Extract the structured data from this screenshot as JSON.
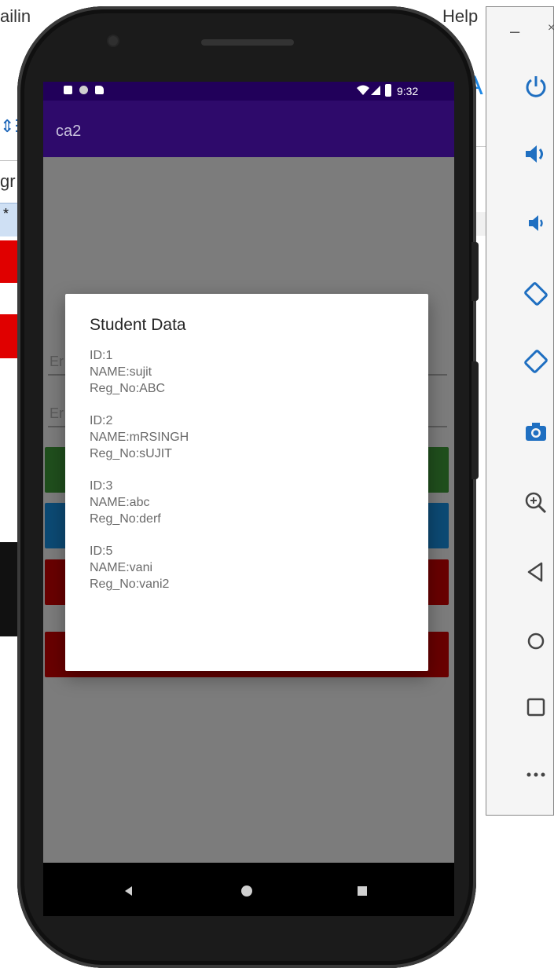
{
  "background": {
    "menu_left": "ailin",
    "menu_right": "Help",
    "left_text": "gr",
    "left_star": "*",
    "right_letter": "A"
  },
  "emulator_toolbar": {
    "minimize": "–",
    "close": "×",
    "buttons": [
      "power-icon",
      "volume-up-icon",
      "volume-down-icon",
      "rotate-left-icon",
      "rotate-right-icon",
      "camera-icon",
      "zoom-icon",
      "back-icon",
      "home-icon",
      "overview-icon",
      "more-icon"
    ]
  },
  "status_bar": {
    "time": "9:32"
  },
  "app": {
    "title": "ca2",
    "hint_1": "Er",
    "hint_2": "Er"
  },
  "dialog": {
    "title": "Student Data",
    "records": [
      {
        "id": "ID:1",
        "name": "NAME:sujit",
        "reg": "Reg_No:ABC"
      },
      {
        "id": "ID:2",
        "name": "NAME:mRSINGH",
        "reg": "Reg_No:sUJIT"
      },
      {
        "id": "ID:3",
        "name": "NAME:abc",
        "reg": "Reg_No:derf"
      },
      {
        "id": "ID:5",
        "name": "NAME:vani",
        "reg": "Reg_No:vani2"
      }
    ]
  },
  "colors": {
    "status_bar": "#21005a",
    "app_bar": "#2e0a6b",
    "scrim": "#7c7c7c",
    "button_green": "#204f1d",
    "button_blue": "#0c4a74",
    "button_red": "#690000"
  }
}
